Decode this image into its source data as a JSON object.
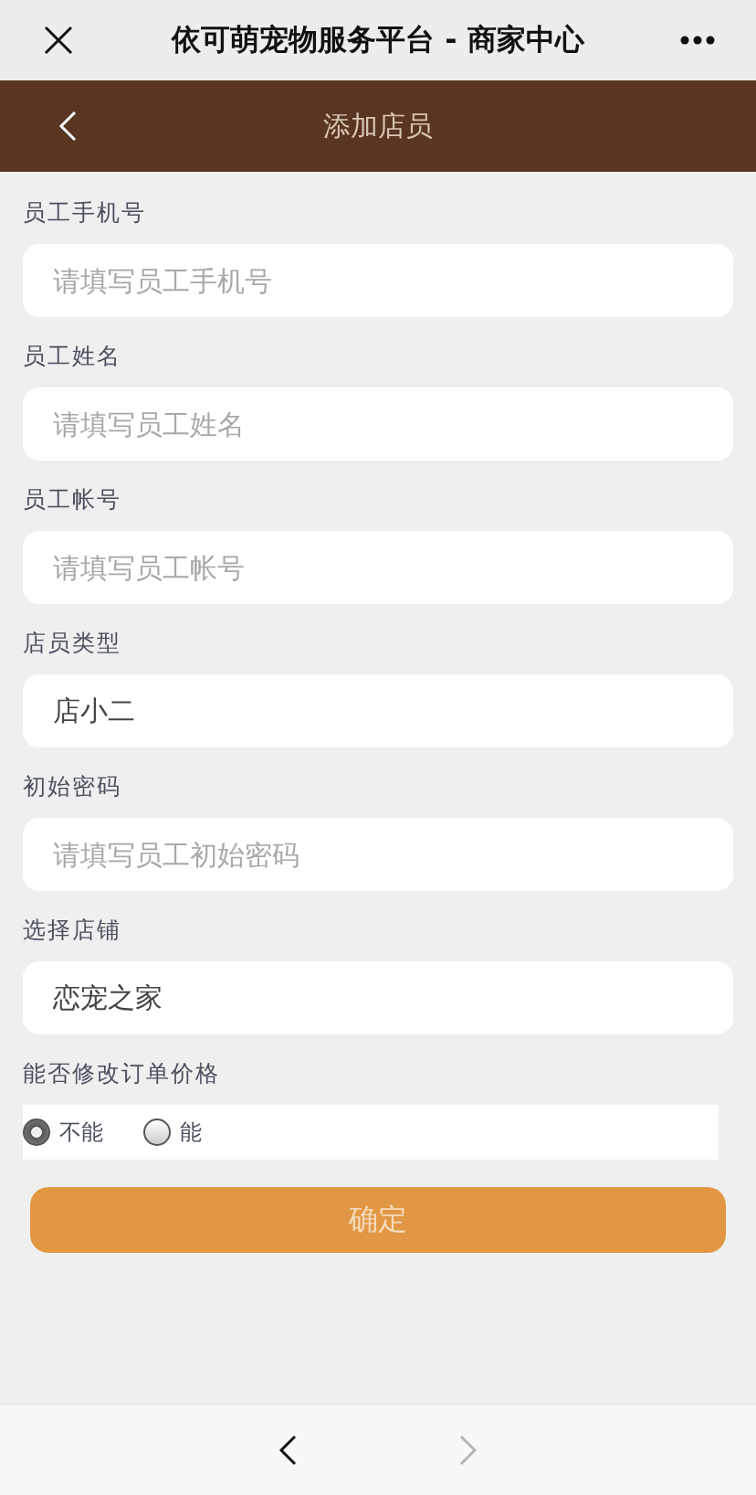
{
  "window": {
    "title": "依可萌宠物服务平台 - 商家中心"
  },
  "header": {
    "title": "添加店员"
  },
  "fields": [
    {
      "label": "员工手机号",
      "placeholder": "请填写员工手机号"
    },
    {
      "label": "员工姓名",
      "placeholder": "请填写员工姓名"
    },
    {
      "label": "员工帐号",
      "placeholder": "请填写员工帐号"
    },
    {
      "label": "店员类型",
      "value": "店小二"
    },
    {
      "label": "初始密码",
      "placeholder": "请填写员工初始密码"
    },
    {
      "label": "选择店铺",
      "value": "恋宠之家"
    }
  ],
  "price_edit": {
    "label": "能否修改订单价格",
    "options": [
      {
        "label": "不能",
        "selected": true
      },
      {
        "label": "能",
        "selected": false
      }
    ]
  },
  "submit": {
    "label": "确定"
  },
  "nav": [
    {
      "kind": "back",
      "disabled": false
    },
    {
      "kind": "forward",
      "disabled": true
    }
  ]
}
